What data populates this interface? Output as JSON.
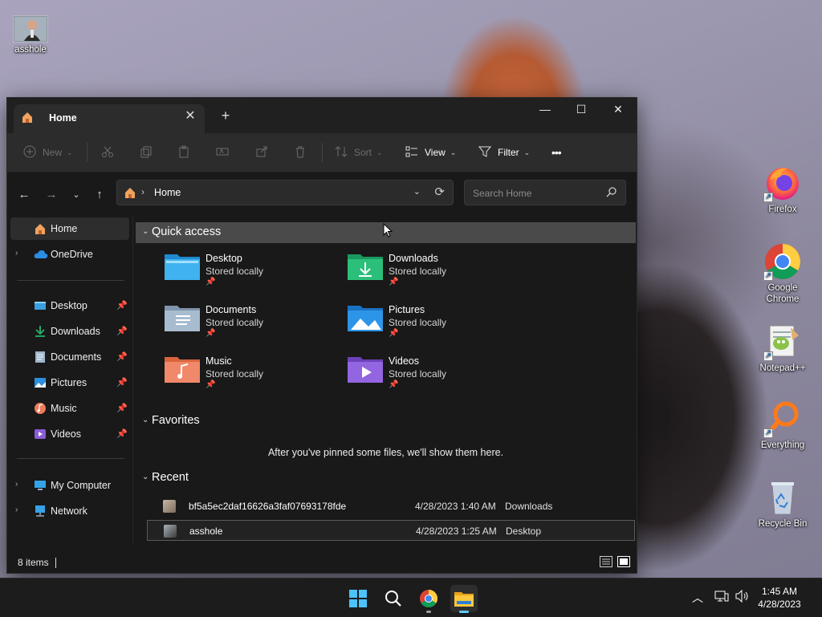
{
  "desktop": {
    "icons": [
      {
        "label": "asshole",
        "icon": "photo-thumbnail"
      },
      {
        "label": "Firefox",
        "icon": "firefox-icon"
      },
      {
        "label": "Google Chrome",
        "icon": "chrome-icon"
      },
      {
        "label": "Notepad++",
        "icon": "notepadpp-icon"
      },
      {
        "label": "Everything",
        "icon": "everything-search-icon"
      },
      {
        "label": "Recycle Bin",
        "icon": "recycle-bin-icon"
      }
    ]
  },
  "explorer": {
    "tab_title": "Home",
    "window_controls": {
      "minimize": "—",
      "maximize": "☐",
      "close": "✕"
    },
    "toolbar": {
      "new_label": "New",
      "sort_label": "Sort",
      "view_label": "View",
      "filter_label": "Filter",
      "more_label": "•••"
    },
    "address": {
      "crumb": "Home"
    },
    "search": {
      "placeholder": "Search Home"
    },
    "nav": {
      "home": "Home",
      "onedrive": "OneDrive",
      "pinned": [
        {
          "label": "Desktop"
        },
        {
          "label": "Downloads"
        },
        {
          "label": "Documents"
        },
        {
          "label": "Pictures"
        },
        {
          "label": "Music"
        },
        {
          "label": "Videos"
        }
      ],
      "my_computer": "My Computer",
      "network": "Network"
    },
    "sections": {
      "quick_access": "Quick access",
      "favorites": "Favorites",
      "recent": "Recent"
    },
    "quick_access": [
      {
        "name": "Desktop",
        "status": "Stored locally"
      },
      {
        "name": "Downloads",
        "status": "Stored locally"
      },
      {
        "name": "Documents",
        "status": "Stored locally"
      },
      {
        "name": "Pictures",
        "status": "Stored locally"
      },
      {
        "name": "Music",
        "status": "Stored locally"
      },
      {
        "name": "Videos",
        "status": "Stored locally"
      }
    ],
    "favorites_empty": "After you've pinned some files, we'll show them here.",
    "recent": [
      {
        "name": "bf5a5ec2daf16626a3faf07693178fde",
        "date": "4/28/2023 1:40 AM",
        "location": "Downloads"
      },
      {
        "name": "asshole",
        "date": "4/28/2023 1:25 AM",
        "location": "Desktop"
      }
    ],
    "status": {
      "item_count": "8 items"
    }
  },
  "taskbar": {
    "clock_time": "1:45 AM",
    "clock_date": "4/28/2023"
  },
  "colors": {
    "accent": "#60cdff",
    "window_bg": "#191919",
    "toolbar_bg": "#2c2c2c"
  }
}
